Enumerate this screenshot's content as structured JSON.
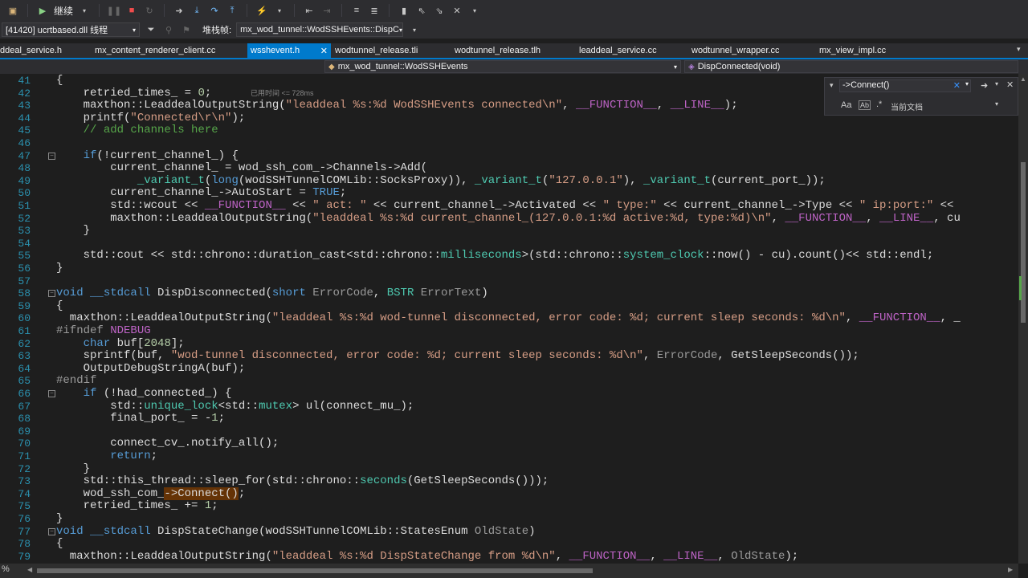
{
  "toolbar": {
    "continue_label": "继续"
  },
  "debug_bar": {
    "process": "[41420] ucrtbased.dll 线程",
    "stack_label": "堆栈帧:",
    "stack_frame": "mx_wod_tunnel::WodSSHEvents::DispC"
  },
  "tabs": [
    "ddeal_service.h",
    "mx_content_renderer_client.cc",
    "wsshevent.h",
    "wodtunnel_release.tli",
    "wodtunnel_release.tlh",
    "leaddeal_service.cc",
    "wodtunnel_wrapper.cc",
    "mx_view_impl.cc"
  ],
  "navbar": {
    "scope": "mx_wod_tunnel::WodSSHEvents",
    "member": "DispConnected(void)"
  },
  "find": {
    "query": "->Connect()",
    "scope_label": "当前文档",
    "opt_case": "Aa",
    "opt_word": "Ab",
    "opt_regex": ".*"
  },
  "inline_hint": "已用时间 <= 728ms",
  "zoom": "%",
  "colors": {
    "accent": "#007acc",
    "background": "#1e1e1e",
    "highlight": "#653306"
  },
  "lines": [
    {
      "n": "41",
      "t": "{"
    },
    {
      "n": "42",
      "t": "    retried_times_ = 0;"
    },
    {
      "n": "43",
      "t": "    maxthon::LeaddealOutputString(\"leaddeal %s:%d WodSSHEvents connected\\n\", __FUNCTION__, __LINE__);"
    },
    {
      "n": "44",
      "t": "    printf(\"Connected\\r\\n\");"
    },
    {
      "n": "45",
      "t": "    // add channels here"
    },
    {
      "n": "46",
      "t": ""
    },
    {
      "n": "47",
      "t": "    if(!current_channel_) {"
    },
    {
      "n": "48",
      "t": "        current_channel_ = wod_ssh_com_->Channels->Add("
    },
    {
      "n": "49",
      "t": "            _variant_t(long(wodSSHTunnelCOMLib::SocksProxy)), _variant_t(\"127.0.0.1\"), _variant_t(current_port_));"
    },
    {
      "n": "50",
      "t": "        current_channel_->AutoStart = TRUE;"
    },
    {
      "n": "51",
      "t": "        std::wcout << __FUNCTION__ << \" act: \" << current_channel_->Activated << \" type:\" << current_channel_->Type << \" ip:port:\" <<"
    },
    {
      "n": "52",
      "t": "        maxthon::LeaddealOutputString(\"leaddeal %s:%d current_channel_(127.0.0.1:%d active:%d, type:%d)\\n\", __FUNCTION__, __LINE__, cu"
    },
    {
      "n": "53",
      "t": "    }"
    },
    {
      "n": "54",
      "t": ""
    },
    {
      "n": "55",
      "t": "    std::cout << std::chrono::duration_cast<std::chrono::milliseconds>(std::chrono::system_clock::now() - cu).count()<< std::endl;"
    },
    {
      "n": "56",
      "t": "}"
    },
    {
      "n": "57",
      "t": ""
    },
    {
      "n": "58",
      "t": "void __stdcall DispDisconnected(short ErrorCode, BSTR ErrorText)"
    },
    {
      "n": "59",
      "t": "{"
    },
    {
      "n": "60",
      "t": "  maxthon::LeaddealOutputString(\"leaddeal %s:%d wod-tunnel disconnected, error code: %d; current sleep seconds: %d\\n\", __FUNCTION__, _"
    },
    {
      "n": "61",
      "t": "#ifndef NDEBUG"
    },
    {
      "n": "62",
      "t": "    char buf[2048];"
    },
    {
      "n": "63",
      "t": "    sprintf(buf, \"wod-tunnel disconnected, error code: %d; current sleep seconds: %d\\n\", ErrorCode, GetSleepSeconds());"
    },
    {
      "n": "64",
      "t": "    OutputDebugStringA(buf);"
    },
    {
      "n": "65",
      "t": "#endif"
    },
    {
      "n": "66",
      "t": "    if (!had_connected_) {"
    },
    {
      "n": "67",
      "t": "        std::unique_lock<std::mutex> ul(connect_mu_);"
    },
    {
      "n": "68",
      "t": "        final_port_ = -1;"
    },
    {
      "n": "69",
      "t": ""
    },
    {
      "n": "70",
      "t": "        connect_cv_.notify_all();"
    },
    {
      "n": "71",
      "t": "        return;"
    },
    {
      "n": "72",
      "t": "    }"
    },
    {
      "n": "73",
      "t": "    std::this_thread::sleep_for(std::chrono::seconds(GetSleepSeconds()));"
    },
    {
      "n": "74",
      "t": "    wod_ssh_com_->Connect();"
    },
    {
      "n": "75",
      "t": "    retried_times_ += 1;"
    },
    {
      "n": "76",
      "t": "}"
    },
    {
      "n": "77",
      "t": "void __stdcall DispStateChange(wodSSHTunnelCOMLib::StatesEnum OldState)"
    },
    {
      "n": "78",
      "t": "{"
    },
    {
      "n": "79",
      "t": "  maxthon::LeaddealOutputString(\"leaddeal %s:%d DispStateChange from %d\\n\", __FUNCTION__, __LINE__, OldState);"
    }
  ]
}
